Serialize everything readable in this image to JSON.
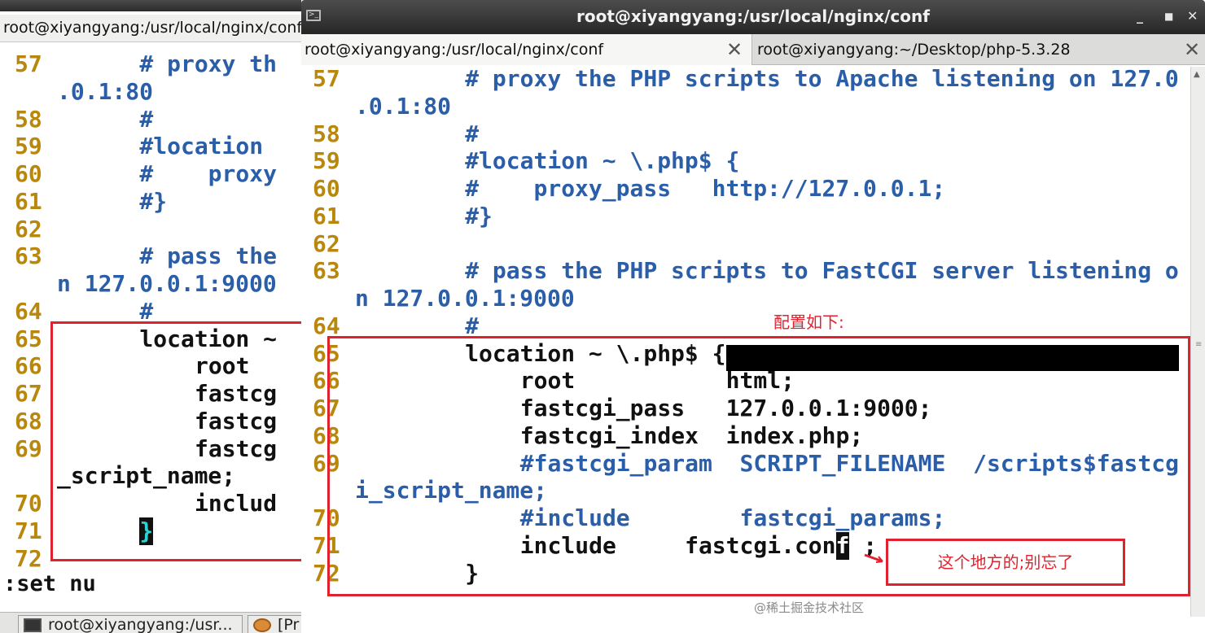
{
  "back_window": {
    "tab_title": "root@xiyangyang:/usr/local/nginx/conf",
    "lines": [
      {
        "num": "57",
        "text": "# proxy th",
        "indent": 6,
        "comment": true
      },
      {
        "num": "",
        "text": ".0.1:80",
        "indent": 0,
        "comment": true
      },
      {
        "num": "58",
        "text": "#",
        "indent": 6,
        "comment": true
      },
      {
        "num": "59",
        "text": "#location",
        "indent": 6,
        "comment": true
      },
      {
        "num": "60",
        "text": "#    proxy",
        "indent": 6,
        "comment": true
      },
      {
        "num": "61",
        "text": "#}",
        "indent": 6,
        "comment": true
      },
      {
        "num": "62",
        "text": "",
        "indent": 0,
        "comment": false
      },
      {
        "num": "63",
        "text": "# pass the",
        "indent": 6,
        "comment": true
      },
      {
        "num": "",
        "text": "n 127.0.0.1:9000",
        "indent": 0,
        "comment": true
      },
      {
        "num": "64",
        "text": "#",
        "indent": 6,
        "comment": true
      },
      {
        "num": "65",
        "text": "location ~",
        "indent": 6,
        "comment": false
      },
      {
        "num": "66",
        "text": "root",
        "indent": 10,
        "comment": false
      },
      {
        "num": "67",
        "text": "fastcg",
        "indent": 10,
        "comment": false
      },
      {
        "num": "68",
        "text": "fastcg",
        "indent": 10,
        "comment": false
      },
      {
        "num": "69",
        "text": "fastcg",
        "indent": 10,
        "comment": false
      },
      {
        "num": "",
        "text": "_script_name;",
        "indent": 0,
        "comment": false
      },
      {
        "num": "70",
        "text": "includ",
        "indent": 10,
        "comment": false
      },
      {
        "num": "71",
        "text": "}",
        "indent": 6,
        "comment": false
      },
      {
        "num": "72",
        "text": "",
        "indent": 0,
        "comment": false
      }
    ],
    "status": ":set nu",
    "taskbar": [
      {
        "label": "root@xiyangyang:/usr..."
      },
      {
        "label": "[Pr"
      }
    ]
  },
  "front_window": {
    "title": "root@xiyangyang:/usr/local/nginx/conf",
    "tabs": [
      {
        "label": "root@xiyangyang:/usr/local/nginx/conf"
      },
      {
        "label": "root@xiyangyang:~/Desktop/php-5.3.28"
      }
    ],
    "lines": [
      {
        "num": "57",
        "text": "# proxy the PHP scripts to Apache listening on 127.0",
        "indent": 8,
        "comment": true
      },
      {
        "num": "",
        "text": ".0.1:80",
        "indent": 0,
        "comment": true
      },
      {
        "num": "58",
        "text": "#",
        "indent": 8,
        "comment": true
      },
      {
        "num": "59",
        "text": "#location ~ \\.php$ {",
        "indent": 8,
        "comment": true
      },
      {
        "num": "60",
        "text": "#    proxy_pass   http://127.0.0.1;",
        "indent": 8,
        "comment": true
      },
      {
        "num": "61",
        "text": "#}",
        "indent": 8,
        "comment": true
      },
      {
        "num": "62",
        "text": "",
        "indent": 0,
        "comment": false
      },
      {
        "num": "63",
        "text": "# pass the PHP scripts to FastCGI server listening o",
        "indent": 8,
        "comment": true
      },
      {
        "num": "",
        "text": "n 127.0.0.1:9000",
        "indent": 0,
        "comment": true
      },
      {
        "num": "64",
        "text": "#",
        "indent": 8,
        "comment": true
      },
      {
        "num": "65",
        "text": "location ~ \\.php$ {",
        "indent": 8,
        "comment": false
      },
      {
        "num": "66",
        "text": "root           html;",
        "indent": 12,
        "comment": false
      },
      {
        "num": "67",
        "text": "fastcgi_pass   127.0.0.1:9000;",
        "indent": 12,
        "comment": false
      },
      {
        "num": "68",
        "text": "fastcgi_index  index.php;",
        "indent": 12,
        "comment": false
      },
      {
        "num": "69",
        "text": "#fastcgi_param  SCRIPT_FILENAME  /scripts$fastcg",
        "indent": 12,
        "comment": true
      },
      {
        "num": "",
        "text": "i_script_name;",
        "indent": 0,
        "comment": true
      },
      {
        "num": "70",
        "text": "#include        fastcgi_params;",
        "indent": 12,
        "comment": true
      },
      {
        "num": "71",
        "text": "include     fastcgi.con",
        "indent": 12,
        "comment": false,
        "cursor": "f",
        "after": " ;"
      },
      {
        "num": "72",
        "text": "}",
        "indent": 8,
        "comment": false
      }
    ]
  },
  "annotations": {
    "config_note": "配置如下:",
    "reminder_note": "这个地方的;别忘了"
  },
  "watermark": "@稀土掘金技术社区",
  "colors": {
    "line_number": "#b8870b",
    "comment": "#2b5ea8",
    "highlight": "#e0222e"
  }
}
